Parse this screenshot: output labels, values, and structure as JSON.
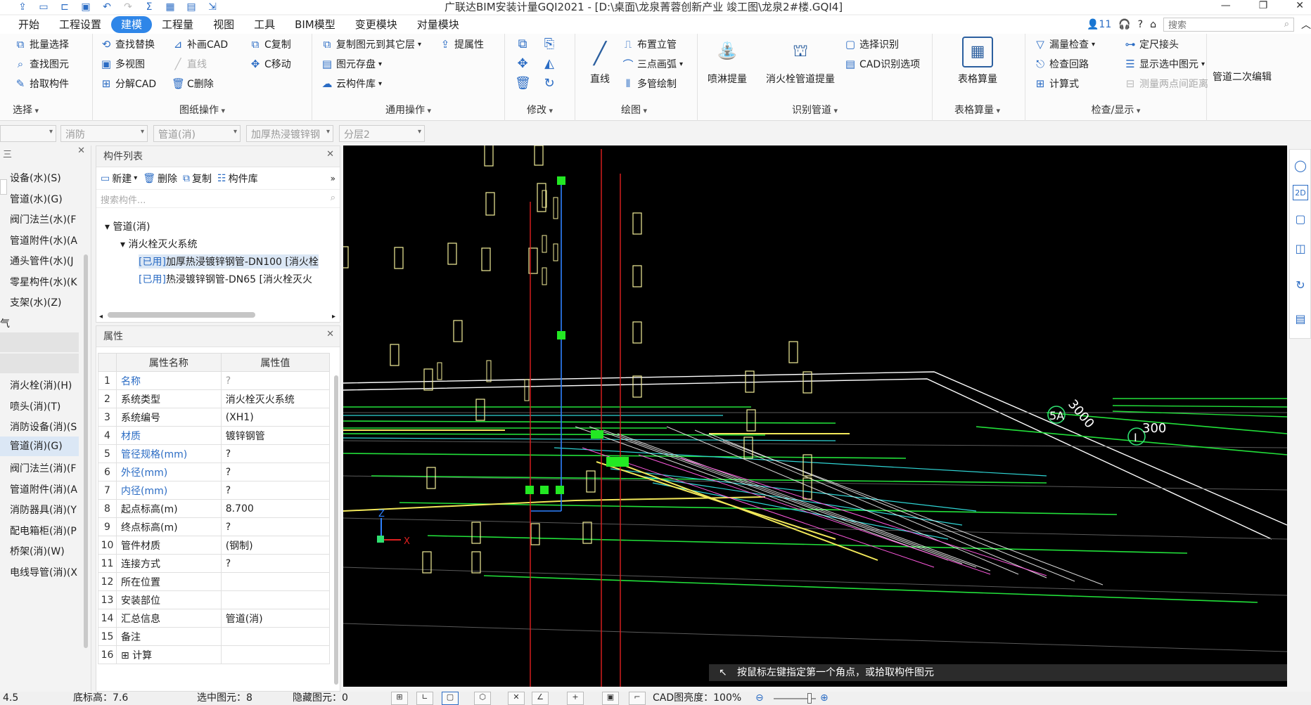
{
  "window": {
    "title": "广联达BIM安装计量GQI2021 - [D:\\桌面\\龙泉菁蓉创新产业 竣工图\\龙泉2#楼.GQI4]",
    "user_badge": "11",
    "search_placeholder": "搜索"
  },
  "menu": [
    "开始",
    "工程设置",
    "建模",
    "工程量",
    "视图",
    "工具",
    "BIM模型",
    "变更模块",
    "对量模块"
  ],
  "menu_active_index": 2,
  "ribbon": {
    "select": {
      "title": "选择",
      "items": [
        "批量选择",
        "查找图元",
        "拾取构件"
      ]
    },
    "drawing_ops": {
      "title": "图纸操作",
      "items": [
        "查找替换",
        "补画CAD",
        "C复制",
        "多视图",
        "直线",
        "C移动",
        "分解CAD",
        "C删除"
      ]
    },
    "general_ops": {
      "title": "通用操作",
      "items": [
        "复制图元到其它层",
        "提属性",
        "图元存盘",
        "云构件库"
      ]
    },
    "modify": {
      "title": "修改"
    },
    "draw": {
      "title": "绘图",
      "items": [
        "直线",
        "布置立管",
        "三点画弧",
        "多管绘制"
      ]
    },
    "recognize": {
      "title": "识别管道",
      "items": [
        "喷淋提量",
        "消火栓管道提量",
        "选择识别",
        "CAD识别选项"
      ]
    },
    "table_calc": {
      "title": "表格算量",
      "items": [
        "表格算量"
      ]
    },
    "check": {
      "title": "检查/显示",
      "items": [
        "漏量检查",
        "定尺接头",
        "检查回路",
        "显示选中图元",
        "计算式",
        "测量两点间距离"
      ]
    },
    "pipe_edit": {
      "items": [
        "管道二次编辑"
      ]
    }
  },
  "filters": [
    "",
    "消防",
    "管道(消)",
    "加厚热浸镀锌钢",
    "分层2"
  ],
  "left_nav": [
    "设备(水)(S)",
    "管道(水)(G)",
    "阀门法兰(水)(F",
    "管道附件(水)(A",
    "通头管件(水)(J",
    "零星构件(水)(K",
    "支架(水)(Z)",
    "气",
    "",
    "",
    "消火栓(消)(H)",
    "喷头(消)(T)",
    "消防设备(消)(S",
    "管道(消)(G)",
    "阀门法兰(消)(F",
    "管道附件(消)(A",
    "消防器具(消)(Y",
    "配电箱柜(消)(P",
    "桥架(消)(W)",
    "电线导管(消)(X"
  ],
  "left_nav_selected": 13,
  "component_list": {
    "title": "构件列表",
    "toolbar": [
      "新建",
      "删除",
      "复制",
      "构件库"
    ],
    "search_placeholder": "搜索构件...",
    "tree": [
      {
        "level": 0,
        "text": "管道(消)"
      },
      {
        "level": 1,
        "text": "消火栓灭火系统"
      },
      {
        "level": 2,
        "tag": "[已用]",
        "text": "加厚热浸镀锌钢管-DN100 [消火栓",
        "selected": true
      },
      {
        "level": 2,
        "tag": "[已用]",
        "text": "热浸镀锌钢管-DN65 [消火栓灭火",
        "selected": false
      }
    ]
  },
  "properties": {
    "title": "属性",
    "headers": [
      "属性名称",
      "属性值"
    ],
    "rows": [
      {
        "n": "1",
        "name": "名称",
        "value": "?",
        "blue": true,
        "q": true
      },
      {
        "n": "2",
        "name": "系统类型",
        "value": "消火栓灭火系统",
        "blue": false
      },
      {
        "n": "3",
        "name": "系统编号",
        "value": "(XH1)",
        "blue": false
      },
      {
        "n": "4",
        "name": "材质",
        "value": "镀锌钢管",
        "blue": true
      },
      {
        "n": "5",
        "name": "管径规格(mm)",
        "value": "?",
        "blue": true
      },
      {
        "n": "6",
        "name": "外径(mm)",
        "value": "?",
        "blue": true
      },
      {
        "n": "7",
        "name": "内径(mm)",
        "value": "?",
        "blue": true
      },
      {
        "n": "8",
        "name": "起点标高(m)",
        "value": "8.700",
        "blue": false
      },
      {
        "n": "9",
        "name": "终点标高(m)",
        "value": "?",
        "blue": false
      },
      {
        "n": "10",
        "name": "管件材质",
        "value": "(钢制)",
        "blue": false
      },
      {
        "n": "11",
        "name": "连接方式",
        "value": "?",
        "blue": false
      },
      {
        "n": "12",
        "name": "所在位置",
        "value": "",
        "blue": false
      },
      {
        "n": "13",
        "name": "安装部位",
        "value": "",
        "blue": false
      },
      {
        "n": "14",
        "name": "汇总信息",
        "value": "管道(消)",
        "blue": false
      },
      {
        "n": "15",
        "name": "备注",
        "value": "",
        "blue": false
      },
      {
        "n": "16",
        "name": "⊞ 计算",
        "value": "",
        "blue": false
      }
    ]
  },
  "viewport": {
    "hint": "按鼠标左键指定第一个角点，或拾取构件图元",
    "axis_labels": [
      "Z",
      "X"
    ],
    "grid_labels": [
      "3000",
      "300",
      "5A",
      "I"
    ]
  },
  "statusbar": {
    "value1": "4.5",
    "bottom_elev": "底标高：7.6",
    "selected": "选中图元：8",
    "hidden": "隐藏图元：0",
    "cad_brightness": "CAD图亮度：100%"
  }
}
